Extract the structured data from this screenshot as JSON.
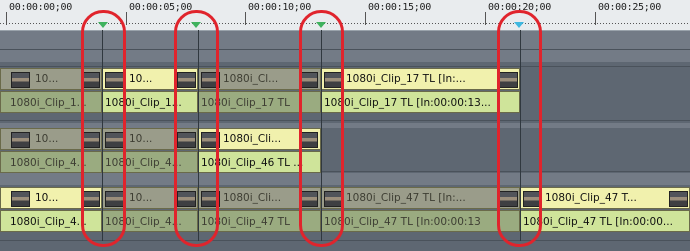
{
  "ruler": {
    "timecodes": [
      "00:00:00;00",
      "00:00:05;00",
      "00:00:10;00",
      "00:00:15;00",
      "00:00:20;00",
      "00:00:25;00"
    ]
  },
  "tracks": {
    "row1": {
      "video": [
        "10...",
        "10...",
        "1080i_Cl...",
        "1080i_Clip_17  TL [In:..."
      ],
      "audio": [
        "1080i_Clip_1...",
        "1080i_Clip_1...",
        "1080i_Clip_17  TL",
        "1080i_Clip_17  TL [In:00:00:13..."
      ]
    },
    "row2": {
      "video": [
        "10...",
        "10...",
        "10...",
        "1080i_Cli..."
      ],
      "audio": [
        "1080i_Clip_4...",
        "1080i_Clip_4...",
        "1080i_Clip_4...",
        "1080i_Clip_46  TL ..."
      ]
    },
    "row3": {
      "video": [
        "10...",
        "10...",
        "10...",
        "1080i_Cli...",
        "1080i_Clip_47  TL [In:...",
        "1080i_Clip_47  T..."
      ],
      "audio": [
        "1080i_Clip_4...",
        "1080i_Clip_4...",
        "1080i_Clip_4...",
        "1080i_Clip_47  TL",
        "1080i_Clip_47  TL [In:00:00:13",
        "1080i_Clip_47  TL [In:00:00..."
      ]
    }
  },
  "colors": {
    "highlight": "#e0242c",
    "clip_video": "#f1f1ad",
    "clip_audio": "#cfe49a",
    "marker_green": "#3fb25e",
    "marker_cyan": "#3fb8e0"
  }
}
